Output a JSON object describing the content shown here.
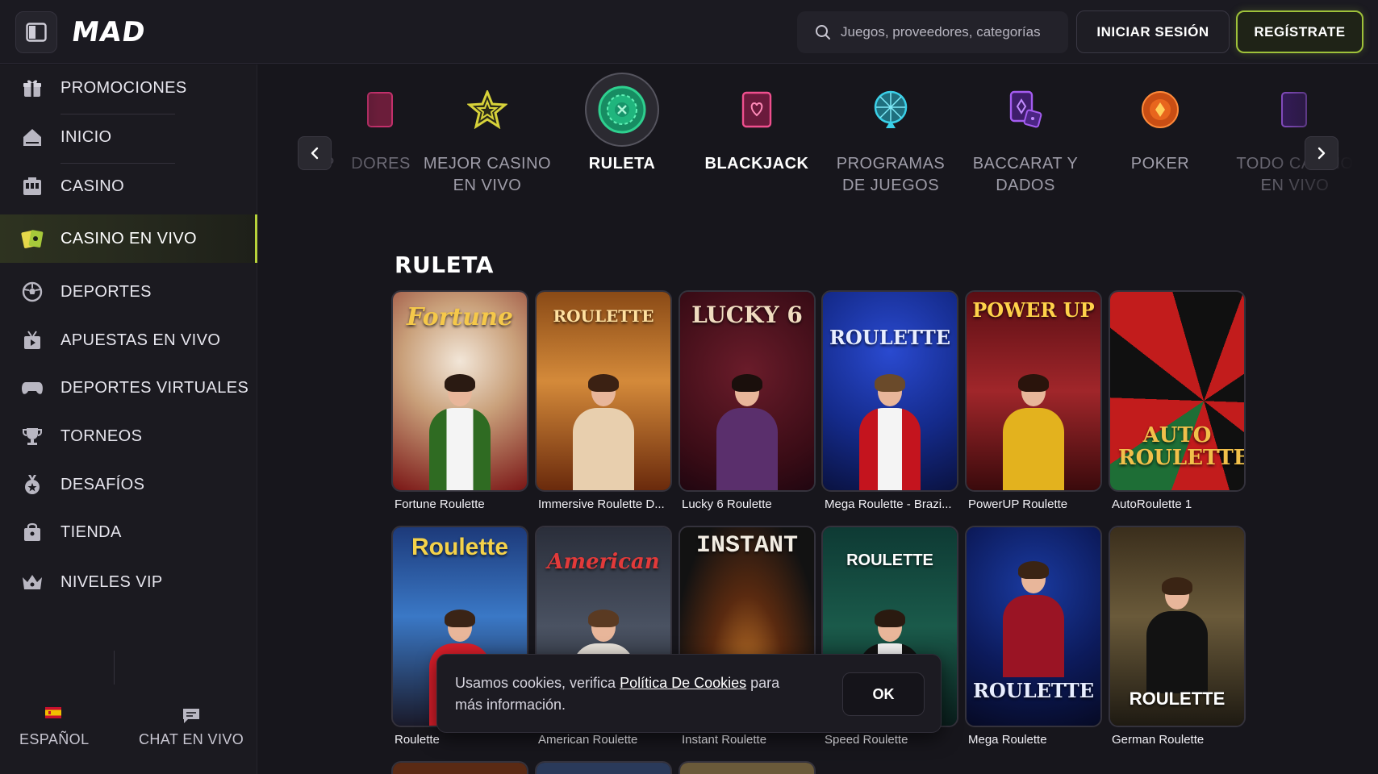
{
  "header": {
    "logo": "MAD",
    "search_placeholder": "Juegos, proveedores, categorías",
    "login_label": "INICIAR SESIÓN",
    "register_label": "REGÍSTRATE"
  },
  "sidebar": {
    "items": [
      {
        "label": "PROMOCIONES",
        "icon": "gift-icon"
      },
      {
        "label": "INICIO",
        "icon": "home-icon"
      },
      {
        "label": "CASINO",
        "icon": "slot-machine-icon"
      },
      {
        "label": "CASINO EN VIVO",
        "icon": "live-cards-icon",
        "active": true
      },
      {
        "label": "DEPORTES",
        "icon": "soccer-ball-icon"
      },
      {
        "label": "APUESTAS EN VIVO",
        "icon": "live-tv-icon"
      },
      {
        "label": "DEPORTES VIRTUALES",
        "icon": "gamepad-icon"
      },
      {
        "label": "TORNEOS",
        "icon": "trophy-icon"
      },
      {
        "label": "DESAFÍOS",
        "icon": "medal-icon"
      },
      {
        "label": "TIENDA",
        "icon": "shopping-bag-icon"
      },
      {
        "label": "NIVELES VIP",
        "icon": "crown-icon"
      }
    ],
    "language": "ESPAÑOL",
    "chat": "CHAT EN VIVO"
  },
  "categories": {
    "items": [
      {
        "label": "P",
        "icon": ""
      },
      {
        "label": "DORES",
        "icon": "card-icon"
      },
      {
        "label": "MEJOR CASINO EN VIVO",
        "icon": "star-icon"
      },
      {
        "label": "RULETA",
        "icon": "roulette-icon",
        "active": true
      },
      {
        "label": "BLACKJACK",
        "icon": "heart-card-icon"
      },
      {
        "label": "PROGRAMAS DE JUEGOS",
        "icon": "wheel-icon"
      },
      {
        "label": "BACCARAT Y DADOS",
        "icon": "cards-dice-icon"
      },
      {
        "label": "POKER",
        "icon": "poker-chip-icon"
      },
      {
        "label": "TODO CASINO EN VIVO",
        "icon": "card-icon"
      }
    ]
  },
  "section": {
    "title": "RULETA"
  },
  "games": [
    {
      "name": "Fortune Roulette",
      "brand": "Fortune"
    },
    {
      "name": "Immersive Roulette D...",
      "brand": "ROULETTE"
    },
    {
      "name": "Lucky 6 Roulette",
      "brand": "LUCKY 6"
    },
    {
      "name": "Mega Roulette - Brazi...",
      "brand": "ROULETTE"
    },
    {
      "name": "PowerUP Roulette",
      "brand": "POWER UP"
    },
    {
      "name": "AutoRoulette 1",
      "brand": "AUTO ROULETTE"
    },
    {
      "name": "Roulette",
      "brand": "Roulette"
    },
    {
      "name": "American Roulette",
      "brand": "American"
    },
    {
      "name": "Instant Roulette",
      "brand": "INSTANT"
    },
    {
      "name": "Speed Roulette",
      "brand": "ROULETTE"
    },
    {
      "name": "Mega Roulette",
      "brand": "ROULETTE"
    },
    {
      "name": "German Roulette",
      "brand": "ROULETTE"
    }
  ],
  "cookie": {
    "text_before": "Usamos cookies, verifica ",
    "link": "Política De Cookies",
    "text_after": " para más información.",
    "ok": "OK"
  },
  "colors": {
    "accent": "#b7d33a",
    "background": "#17161c",
    "sidebar": "#1b1a20"
  }
}
